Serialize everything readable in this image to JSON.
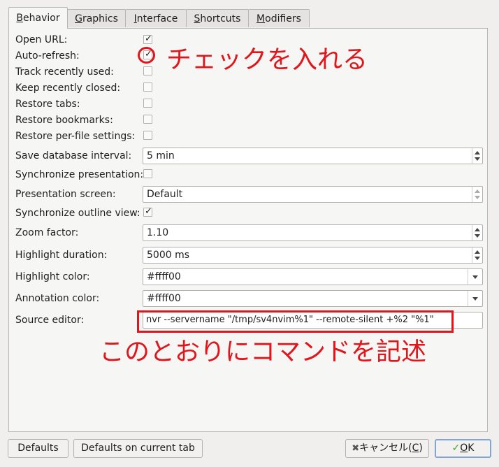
{
  "tabs": [
    {
      "label": "Behavior",
      "mnemonic": "B",
      "rest": "ehavior"
    },
    {
      "label": "Graphics",
      "mnemonic": "G",
      "rest": "raphics"
    },
    {
      "label": "Interface",
      "mnemonic": "I",
      "rest": "nterface"
    },
    {
      "label": "Shortcuts",
      "mnemonic": "S",
      "rest": "hortcuts"
    },
    {
      "label": "Modifiers",
      "mnemonic": "M",
      "rest": "odifiers"
    }
  ],
  "settings": {
    "open_url": {
      "label": "Open URL:",
      "checked": true
    },
    "auto_refresh": {
      "label": "Auto-refresh:",
      "checked": true
    },
    "track_recently_used": {
      "label": "Track recently used:",
      "checked": false
    },
    "keep_recently_closed": {
      "label": "Keep recently closed:",
      "checked": false
    },
    "restore_tabs": {
      "label": "Restore tabs:",
      "checked": false
    },
    "restore_bookmarks": {
      "label": "Restore bookmarks:",
      "checked": false
    },
    "restore_per_file_settings": {
      "label": "Restore per-file settings:",
      "checked": false
    },
    "save_database_interval": {
      "label": "Save database interval:",
      "value": "5 min"
    },
    "synchronize_presentation": {
      "label": "Synchronize presentation:",
      "checked": false
    },
    "presentation_screen": {
      "label": "Presentation screen:",
      "value": "Default"
    },
    "synchronize_outline_view": {
      "label": "Synchronize outline view:",
      "checked": true
    },
    "zoom_factor": {
      "label": "Zoom factor:",
      "value": "1.10"
    },
    "highlight_duration": {
      "label": "Highlight duration:",
      "value": "5000 ms"
    },
    "highlight_color": {
      "label": "Highlight color:",
      "value": "#ffff00"
    },
    "annotation_color": {
      "label": "Annotation color:",
      "value": "#ffff00"
    },
    "source_editor": {
      "label": "Source editor:",
      "value": "nvr --servername \"/tmp/sv4nvim%1\" --remote-silent +%2 \"%1\""
    }
  },
  "annotations": {
    "checkbox_note": "チェックを入れる",
    "command_note": "このとおりにコマンドを記述"
  },
  "footer": {
    "defaults_label": "Defaults",
    "defaults_current_tab_label": "Defaults on current tab",
    "cancel_text": "キャンセル(",
    "cancel_mnemonic": "C",
    "cancel_tail": ")",
    "ok_mnemonic": "O",
    "ok_rest": "K"
  },
  "colors": {
    "annotation_red": "#e0161c",
    "ok_focus": "#7ea7d8",
    "ok_check_green": "#4aa02c",
    "cancel_x": "#555555"
  },
  "icons": {
    "check": "check-icon",
    "cancel": "cancel-x-icon",
    "ok": "ok-check-icon"
  }
}
